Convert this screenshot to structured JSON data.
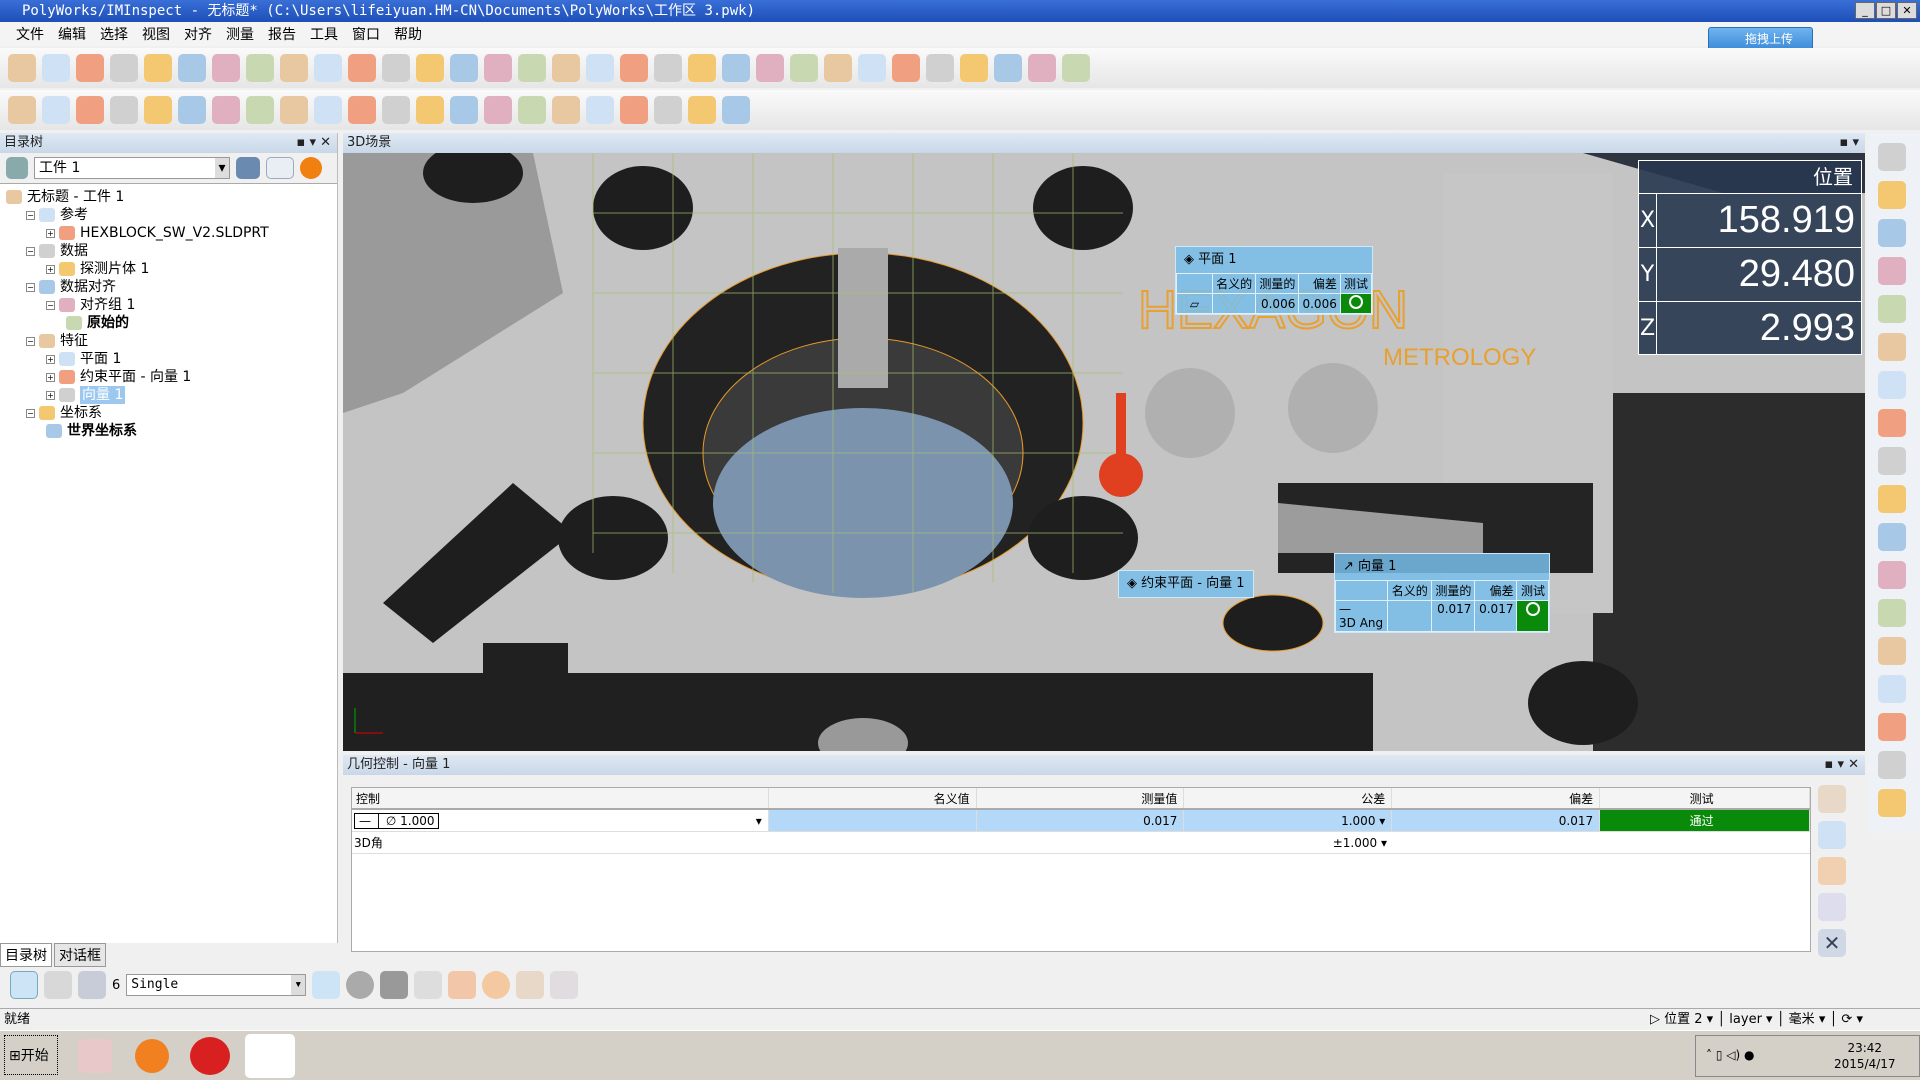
{
  "window": {
    "title": "PolyWorks/IMInspect - 无标题* (C:\\Users\\lifeiyuan.HM-CN\\Documents\\PolyWorks\\工作区 3.pwk)",
    "min": "_",
    "max": "□",
    "close": "✕"
  },
  "menu": [
    "文件",
    "编辑",
    "选择",
    "视图",
    "对齐",
    "测量",
    "报告",
    "工具",
    "窗口",
    "帮助"
  ],
  "upload_button": "拖拽上传",
  "left_panel": {
    "title": "目录树",
    "combo_value": "工件 1",
    "tree": [
      {
        "label": "无标题 - 工件 1",
        "level": 0,
        "bold": false
      },
      {
        "label": "参考",
        "level": 1,
        "toggle": "−"
      },
      {
        "label": "HEXBLOCK_SW_V2.SLDPRT",
        "level": 2,
        "toggle": "+"
      },
      {
        "label": "数据",
        "level": 1,
        "toggle": "−"
      },
      {
        "label": "探测片体 1",
        "level": 2,
        "toggle": "+"
      },
      {
        "label": "数据对齐",
        "level": 1,
        "toggle": "−"
      },
      {
        "label": "对齐组 1",
        "level": 2,
        "toggle": "−"
      },
      {
        "label": "原始的",
        "level": 3,
        "bold": true
      },
      {
        "label": "特征",
        "level": 1,
        "toggle": "−"
      },
      {
        "label": "平面 1",
        "level": 2,
        "toggle": "+"
      },
      {
        "label": "约束平面 - 向量 1",
        "level": 2,
        "toggle": "+"
      },
      {
        "label": "向量 1",
        "level": 2,
        "toggle": "+",
        "selected": true
      },
      {
        "label": "坐标系",
        "level": 1,
        "toggle": "−"
      },
      {
        "label": "世界坐标系",
        "level": 2,
        "bold": true
      }
    ],
    "tabs": [
      "目录树",
      "对话框"
    ]
  },
  "scene": {
    "title": "3D场景",
    "logo": "HEXAGON",
    "logo_sub": "METROLOGY",
    "position": {
      "title": "位置",
      "x": "158.919",
      "y": "29.480",
      "z": "2.993"
    },
    "callout_plane": {
      "title": "平面 1",
      "headers": [
        "名义的",
        "测量的",
        "偏差",
        "测试"
      ],
      "measured": "0.006",
      "deviation": "0.006"
    },
    "callout_constraint": {
      "title": "约束平面 - 向量 1"
    },
    "callout_vector": {
      "title": "向量 1",
      "headers": [
        "名义的",
        "测量的",
        "偏差",
        "测试"
      ],
      "measured": "0.017",
      "deviation": "0.017",
      "row_label": "3D Ang"
    }
  },
  "geometry_control": {
    "title": "几何控制 - 向量 1",
    "headers": [
      "控制",
      "名义值",
      "测量值",
      "公差",
      "偏差",
      "测试"
    ],
    "row1": {
      "control": "1.000",
      "measured": "0.017",
      "tolerance": "1.000",
      "deviation": "0.017",
      "test": "通过"
    },
    "row2": {
      "label": "3D角",
      "tolerance": "±1.000"
    }
  },
  "bottom_toolbar": {
    "mode": "Single",
    "count": "6"
  },
  "status": {
    "text": "就绪",
    "position": "位置 2",
    "layer": "layer",
    "units": "毫米"
  },
  "taskbar": {
    "start": "开始",
    "time": "23:42",
    "date": "2015/4/17"
  },
  "colors": {
    "pass": "#0a8a0a",
    "selection": "#9cc8f0",
    "callout": "#78bee b"
  }
}
